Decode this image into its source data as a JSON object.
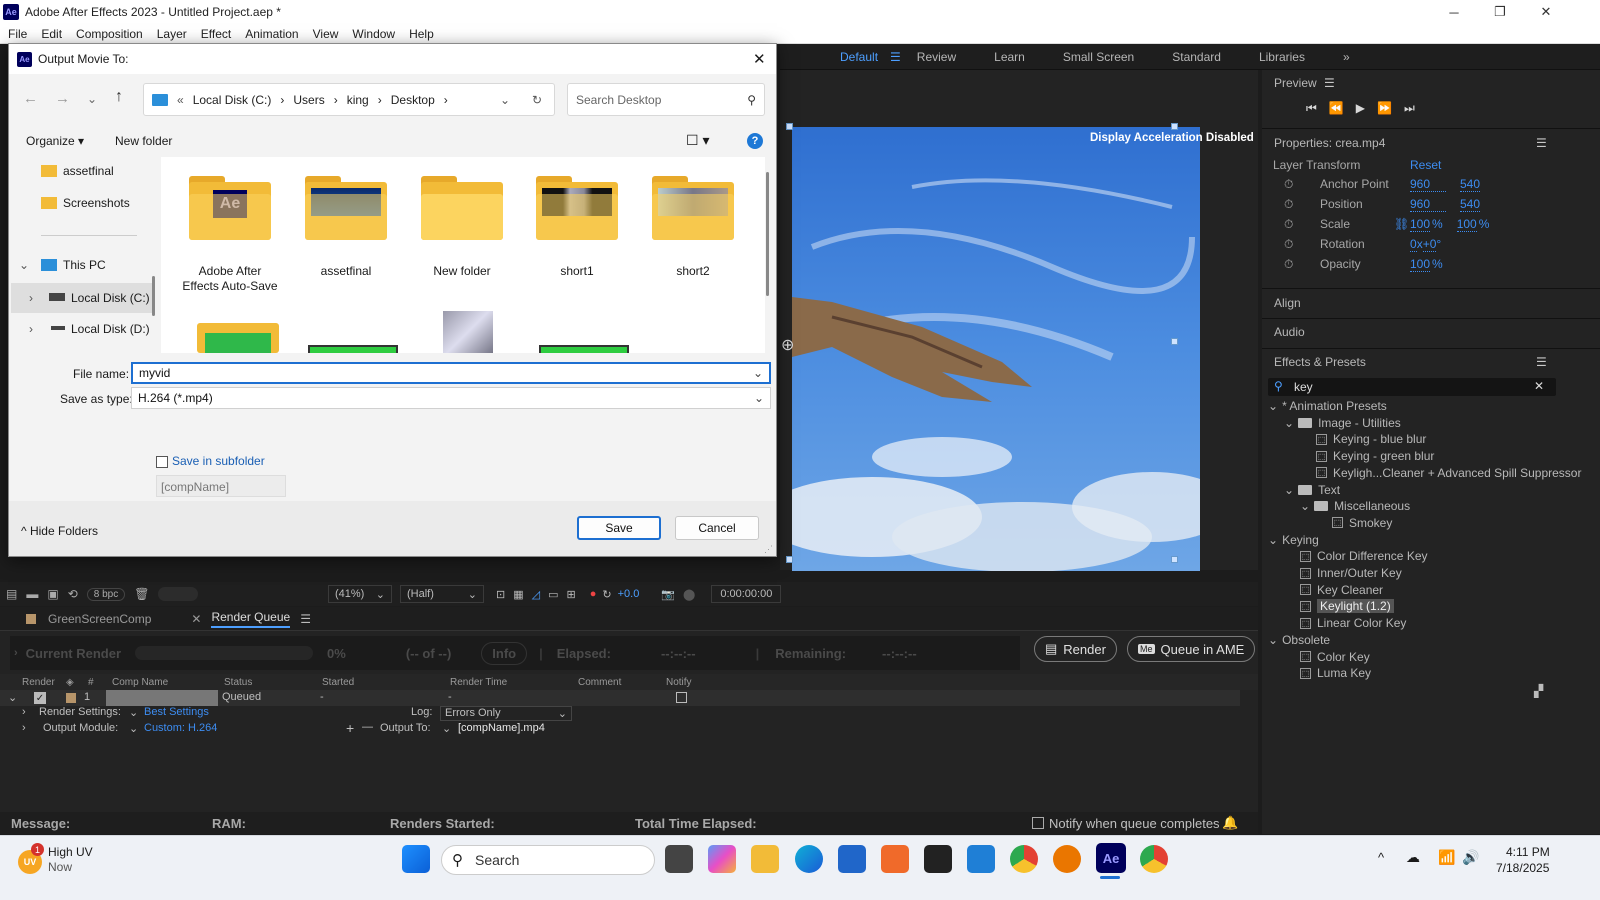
{
  "app": {
    "title": "Adobe After Effects 2023 - Untitled Project.aep *",
    "logo": "Ae",
    "menu": [
      "File",
      "Edit",
      "Composition",
      "Layer",
      "Effect",
      "Animation",
      "View",
      "Window",
      "Help"
    ]
  },
  "workspaces": {
    "items": [
      "Default",
      "Review",
      "Learn",
      "Small Screen",
      "Standard",
      "Libraries"
    ],
    "active": "Default"
  },
  "viewer": {
    "overlay": "Display Acceleration Disabled",
    "bpc": "8 bpc",
    "zoom": "(41%)",
    "resolution": "(Half)",
    "exposure": "+0.0",
    "timecode": "0:00:00:00"
  },
  "preview": {
    "title": "Preview"
  },
  "properties": {
    "title": "Properties: crea.mp4",
    "section": "Layer Transform",
    "reset": "Reset",
    "rows": [
      {
        "label": "Anchor Point",
        "v1": "960",
        "v2": "540"
      },
      {
        "label": "Position",
        "v1": "960",
        "v2": "540"
      },
      {
        "label": "Scale",
        "v1": "100",
        "u1": "%",
        "v2": "100",
        "u2": "%"
      },
      {
        "label": "Rotation",
        "v1": "0",
        "u1": "x",
        "v2": "+0",
        "u2": "°"
      },
      {
        "label": "Opacity",
        "v1": "100",
        "u1": "%"
      }
    ]
  },
  "panels": {
    "align": "Align",
    "audio": "Audio",
    "effects": "Effects & Presets"
  },
  "effects": {
    "search_value": "key",
    "tree": [
      {
        "label": "* Animation Presets",
        "level": 0,
        "kind": "twirl"
      },
      {
        "label": "Image - Utilities",
        "level": 1,
        "kind": "folder"
      },
      {
        "label": "Keying - blue blur",
        "level": 2,
        "kind": "preset"
      },
      {
        "label": "Keying - green blur",
        "level": 2,
        "kind": "preset"
      },
      {
        "label": "Keyligh...Cleaner + Advanced Spill Suppressor",
        "level": 2,
        "kind": "preset"
      },
      {
        "label": "Text",
        "level": 1,
        "kind": "folder"
      },
      {
        "label": "Miscellaneous",
        "level": 2,
        "kind": "folder"
      },
      {
        "label": "Smokey",
        "level": 3,
        "kind": "preset"
      },
      {
        "label": "Keying",
        "level": 0,
        "kind": "twirl"
      },
      {
        "label": "Color Difference Key",
        "level": 1,
        "kind": "effect"
      },
      {
        "label": "Inner/Outer Key",
        "level": 1,
        "kind": "effect"
      },
      {
        "label": "Key Cleaner",
        "level": 1,
        "kind": "effect"
      },
      {
        "label": "Keylight (1.2)",
        "level": 1,
        "kind": "effect",
        "selected": true
      },
      {
        "label": "Linear Color Key",
        "level": 1,
        "kind": "effect"
      },
      {
        "label": "Obsolete",
        "level": 0,
        "kind": "twirl"
      },
      {
        "label": "Color Key",
        "level": 1,
        "kind": "effect"
      },
      {
        "label": "Luma Key",
        "level": 1,
        "kind": "effect"
      }
    ]
  },
  "render_queue": {
    "tabs": [
      "GreenScreenComp",
      "Render Queue"
    ],
    "current_render": "Current Render",
    "percent": "0%",
    "of": "(-- of --)",
    "info": "Info",
    "elapsed_label": "Elapsed:",
    "elapsed_value": "--:--:--",
    "remaining_label": "Remaining:",
    "remaining_value": "--:--:--",
    "render_btn": "Render",
    "queue_btn": "Queue in AME",
    "columns": [
      "Render",
      "#",
      "Comp Name",
      "Status",
      "Started",
      "Render Time",
      "Comment",
      "Notify"
    ],
    "row": {
      "num": "1",
      "status": "Queued",
      "started": "-",
      "render_time": "-"
    },
    "render_settings_label": "Render Settings:",
    "render_settings_value": "Best Settings",
    "output_module_label": "Output Module:",
    "output_module_value": "Custom: H.264",
    "log_label": "Log:",
    "log_value": "Errors Only",
    "output_to_label": "Output To:",
    "output_to_value": "[compName].mp4",
    "message": "Message:",
    "ram": "RAM:",
    "renders_started": "Renders Started:",
    "total_time": "Total Time Elapsed:",
    "notify_label": "Notify when queue completes"
  },
  "dialog": {
    "title": "Output Movie To:",
    "breadcrumb": [
      "«",
      "Local Disk (C:)",
      "Users",
      "king",
      "Desktop"
    ],
    "search_placeholder": "Search Desktop",
    "organize": "Organize",
    "new_folder": "New folder",
    "nav_items": [
      {
        "label": "assetfinal",
        "kind": "folder"
      },
      {
        "label": "Screenshots",
        "kind": "folder"
      },
      {
        "label": "This PC",
        "kind": "pc"
      },
      {
        "label": "Local Disk (C:)",
        "kind": "drive",
        "selected": true
      },
      {
        "label": "Local Disk (D:)",
        "kind": "drive"
      }
    ],
    "files": [
      {
        "name": "Adobe After Effects Auto-Save",
        "thumb": "ae"
      },
      {
        "name": "assetfinal",
        "thumb": "blue"
      },
      {
        "name": "New folder",
        "thumb": "empty"
      },
      {
        "name": "short1",
        "thumb": "photo1"
      },
      {
        "name": "short2",
        "thumb": "photo2"
      }
    ],
    "file_name_label": "File name:",
    "file_name_value": "myvid",
    "save_type_label": "Save as type:",
    "save_type_value": "H.264 (*.mp4)",
    "subfolder_label": "Save in subfolder",
    "subfolder_placeholder": "[compName]",
    "hide_folders": "Hide Folders",
    "save": "Save",
    "cancel": "Cancel"
  },
  "taskbar": {
    "weather_title": "High UV",
    "weather_sub": "Now",
    "weather_badge": "1",
    "search": "Search",
    "time": "4:11 PM",
    "date": "7/18/2025"
  }
}
